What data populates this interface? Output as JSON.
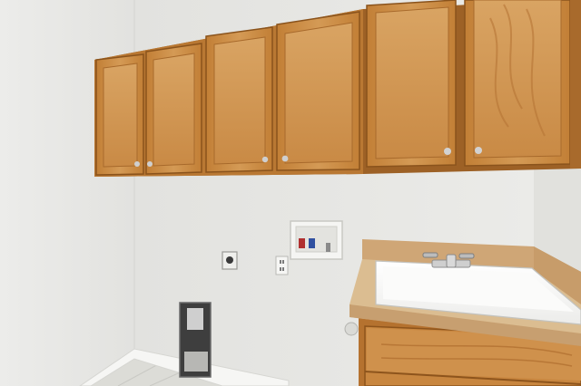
{
  "scene": {
    "subject": "laundry-room",
    "palette": {
      "left_wall": "#eaeae7",
      "back_wall": "#e6e6e3",
      "right_wall": "#e3e3df",
      "cabinet_wood": "#c8883f",
      "cabinet_dark": "#9a5e22",
      "cabinet_light": "#d8a05a",
      "countertop": "#d9b98c",
      "sink": "#f7f7f5",
      "baseboard": "#f4f4f2",
      "floor_tile": "#dcdcd8",
      "hardware": "#c9c9c9"
    },
    "objects": [
      "upper-cabinets",
      "washer-box",
      "dryer-outlet",
      "wall-outlet",
      "dryer-vent",
      "utility-sink",
      "faucet",
      "vanity-base",
      "baseboard",
      "tile-floor"
    ]
  }
}
